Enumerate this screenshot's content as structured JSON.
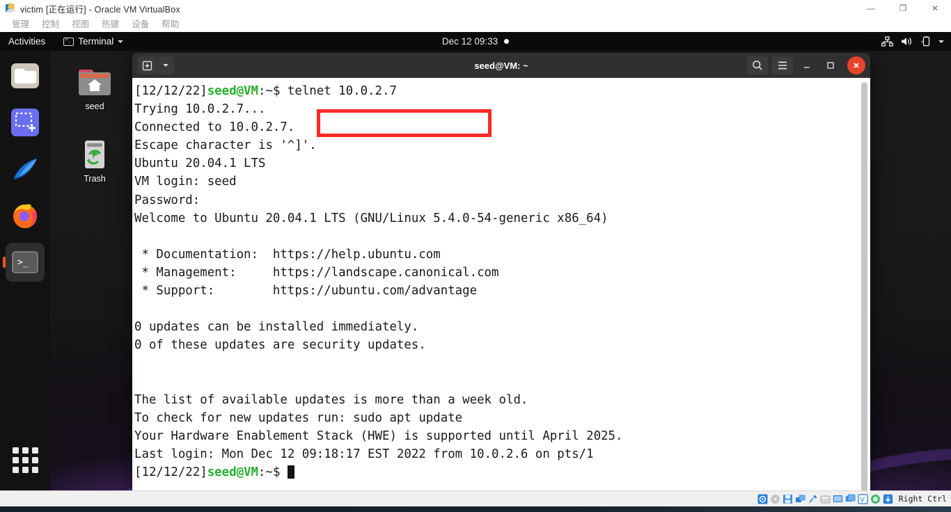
{
  "host_window": {
    "title": "victim [正在运行] - Oracle VM VirtualBox",
    "app_icon": "virtualbox-icon",
    "window_buttons": [
      {
        "name": "minimize",
        "glyph": "—"
      },
      {
        "name": "restore",
        "glyph": "❐"
      },
      {
        "name": "close",
        "glyph": "✕"
      }
    ],
    "menu": [
      {
        "label": "管理"
      },
      {
        "label": "控制"
      },
      {
        "label": "视图"
      },
      {
        "label": "热键"
      },
      {
        "label": "设备"
      },
      {
        "label": "帮助"
      }
    ]
  },
  "gnome_topbar": {
    "activities": "Activities",
    "app_menu": {
      "icon": "terminal-icon",
      "label": "Terminal",
      "caret": "chevron-down-icon"
    },
    "clock": "Dec 12  09:33",
    "notification_dot": true,
    "tray_icons": [
      "network-icon",
      "volume-icon",
      "battery-charging-icon",
      "chevron-down-icon"
    ]
  },
  "dock": {
    "items": [
      {
        "name": "files",
        "icon": "files-folder-icon",
        "active": false
      },
      {
        "name": "screenshot",
        "icon": "screenshot-icon",
        "active": false
      },
      {
        "name": "wireshark",
        "icon": "wireshark-fin-icon",
        "active": false
      },
      {
        "name": "firefox",
        "icon": "firefox-icon",
        "active": false
      },
      {
        "name": "terminal",
        "icon": "terminal-icon",
        "active": true
      }
    ],
    "show_applications": {
      "name": "show-applications",
      "icon": "grid-icon"
    }
  },
  "desktop_icons": [
    {
      "label": "seed",
      "icon": "home-folder-icon"
    },
    {
      "label": "Trash",
      "icon": "trash-icon"
    }
  ],
  "terminal": {
    "title": "seed@VM: ~",
    "header_buttons": {
      "new_tab": "new-tab-icon",
      "dropdown": "chevron-down-icon",
      "search": "search-icon",
      "menu": "hamburger-menu-icon",
      "minimize": "minimize-icon",
      "maximize": "maximize-icon",
      "close": "close-icon"
    },
    "prompt_prefix": "[12/12/22]",
    "prompt_user_host": "seed@VM",
    "prompt_suffix": ":~$ ",
    "command": "telnet 10.0.2.7",
    "lines": [
      "Trying 10.0.2.7...",
      "Connected to 10.0.2.7.",
      "Escape character is '^]'.",
      "Ubuntu 20.04.1 LTS",
      "VM login: seed",
      "Password:",
      "Welcome to Ubuntu 20.04.1 LTS (GNU/Linux 5.4.0-54-generic x86_64)",
      "",
      " * Documentation:  https://help.ubuntu.com",
      " * Management:     https://landscape.canonical.com",
      " * Support:        https://ubuntu.com/advantage",
      "",
      "0 updates can be installed immediately.",
      "0 of these updates are security updates.",
      "",
      "",
      "The list of available updates is more than a week old.",
      "To check for new updates run: sudo apt update",
      "Your Hardware Enablement Stack (HWE) is supported until April 2025.",
      "Last login: Mon Dec 12 09:18:17 EST 2022 from 10.0.2.6 on pts/1"
    ],
    "colors": {
      "prompt_green": "#27ae2c",
      "background": "#ffffff",
      "foreground": "#1a1a1a"
    }
  },
  "annotation": {
    "name": "red-highlight-box",
    "color": "#fb2a28",
    "target": "telnet 10.0.2.7"
  },
  "vbox_statusbar": {
    "host_key": "Right Ctrl",
    "icons": [
      "hard-disk-icon",
      "optical-disk-icon",
      "floppy-icon",
      "network-icon",
      "usb-icon",
      "shared-folder-icon",
      "display-icon",
      "recording-icon",
      "virtualization-icon",
      "mouse-integration-icon",
      "host-key-icon"
    ]
  }
}
